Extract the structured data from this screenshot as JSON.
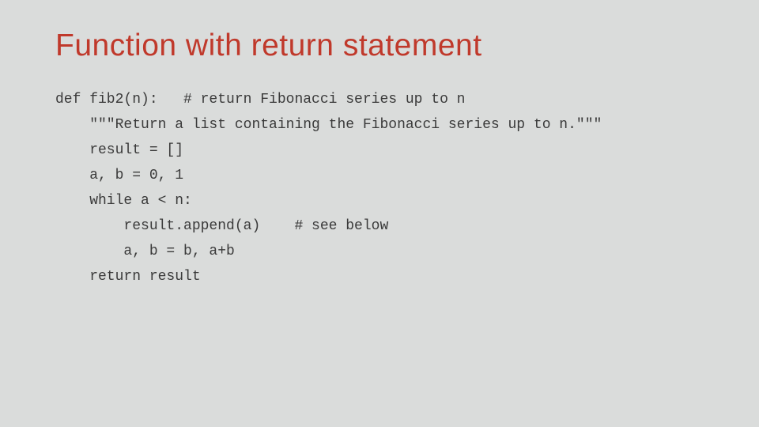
{
  "title": "Function with return statement",
  "code": {
    "l1": "def fib2(n):   # return Fibonacci series up to n",
    "l2": "    \"\"\"Return a list containing the Fibonacci series up to n.\"\"\"",
    "l3": "    result = []",
    "l4": "    a, b = 0, 1",
    "l5": "    while a < n:",
    "l6": "        result.append(a)    # see below",
    "l7": "        a, b = b, a+b",
    "l8": "    return result"
  }
}
